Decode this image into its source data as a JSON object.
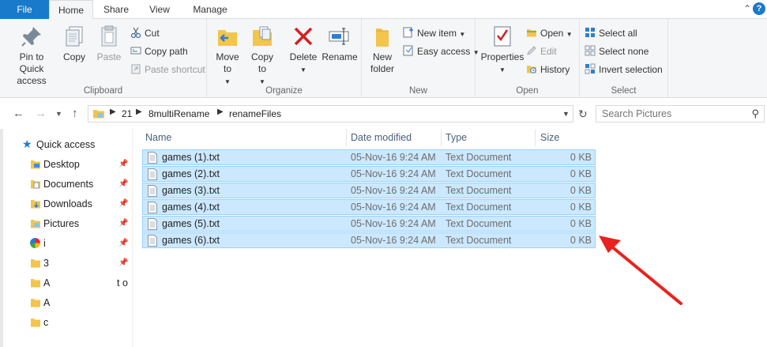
{
  "tabs": {
    "file": "File",
    "home": "Home",
    "share": "Share",
    "view": "View",
    "manage": "Manage"
  },
  "help_icon": "?",
  "ribbon": {
    "clipboard": {
      "label": "Clipboard",
      "pin": "Pin to Quick access",
      "copy": "Copy",
      "paste": "Paste",
      "cut": "Cut",
      "copy_path": "Copy path",
      "paste_shortcut": "Paste shortcut"
    },
    "organize": {
      "label": "Organize",
      "move_to": "Move to",
      "copy_to": "Copy to",
      "delete": "Delete",
      "rename": "Rename"
    },
    "new": {
      "label": "New",
      "new_folder": "New folder",
      "new_item": "New item",
      "easy_access": "Easy access"
    },
    "open": {
      "label": "Open",
      "properties": "Properties",
      "open": "Open",
      "edit": "Edit",
      "history": "History"
    },
    "select": {
      "label": "Select",
      "select_all": "Select all",
      "select_none": "Select none",
      "invert": "Invert selection"
    }
  },
  "address": {
    "segments": [
      "21",
      "8multiRename",
      "renameFiles"
    ]
  },
  "search": {
    "placeholder": "Search Pictures"
  },
  "nav": {
    "quick_access": "Quick access",
    "items": [
      {
        "label": "Desktop"
      },
      {
        "label": "Documents"
      },
      {
        "label": "Downloads"
      },
      {
        "label": "Pictures"
      },
      {
        "label": "i"
      },
      {
        "label": "3"
      },
      {
        "label": "A",
        "tail": "t o"
      },
      {
        "label": "A"
      },
      {
        "label": "c"
      }
    ]
  },
  "columns": {
    "name": "Name",
    "date": "Date modified",
    "type": "Type",
    "size": "Size"
  },
  "files": [
    {
      "name": "games (1).txt",
      "date": "05-Nov-16 9:24 AM",
      "type": "Text Document",
      "size": "0 KB"
    },
    {
      "name": "games (2).txt",
      "date": "05-Nov-16 9:24 AM",
      "type": "Text Document",
      "size": "0 KB"
    },
    {
      "name": "games (3).txt",
      "date": "05-Nov-16 9:24 AM",
      "type": "Text Document",
      "size": "0 KB"
    },
    {
      "name": "games (4).txt",
      "date": "05-Nov-16 9:24 AM",
      "type": "Text Document",
      "size": "0 KB"
    },
    {
      "name": "games (5).txt",
      "date": "05-Nov-16 9:24 AM",
      "type": "Text Document",
      "size": "0 KB"
    },
    {
      "name": "games (6).txt",
      "date": "05-Nov-16 9:24 AM",
      "type": "Text Document",
      "size": "0 KB"
    }
  ],
  "colors": {
    "file_tab": "#1979ca",
    "selection_fill": "#cce8ff",
    "selection_border": "#99d1ff",
    "annotation_arrow": "#e8231f"
  }
}
